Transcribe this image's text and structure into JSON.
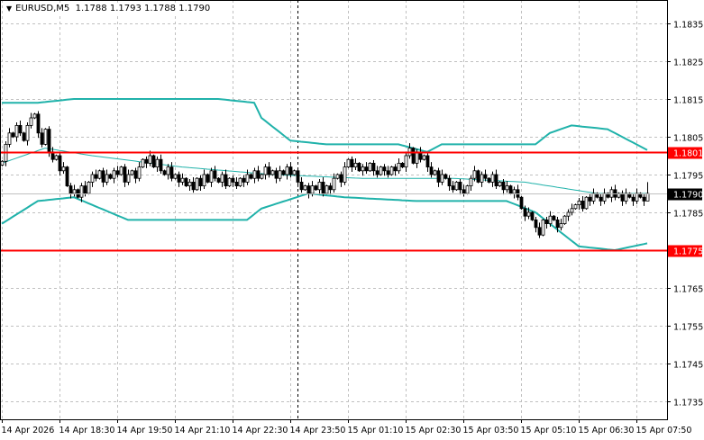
{
  "header": {
    "symbol": "EURUSD,M5",
    "open": "1.1788",
    "high": "1.1793",
    "low": "1.1788",
    "close": "1.1790"
  },
  "colors": {
    "bands": "#20b2aa",
    "level": "#ff0000",
    "bull_body": "#ffffff",
    "bear_body": "#000000",
    "grid": "#c0c0c0",
    "current_bg": "#000000"
  },
  "chart_data": {
    "type": "candlestick",
    "title": "EURUSD,M5",
    "ylim": [
      1.1731,
      1.1841
    ],
    "y_ticks": [
      "1.1835",
      "1.1825",
      "1.1815",
      "1.1805",
      "1.1795",
      "1.1785",
      "1.1775",
      "1.1765",
      "1.1755",
      "1.1745",
      "1.1735"
    ],
    "x_ticks": [
      "14 Apr 2026",
      "14 Apr 18:30",
      "14 Apr 19:50",
      "14 Apr 21:10",
      "14 Apr 22:30",
      "14 Apr 23:50",
      "15 Apr 01:10",
      "15 Apr 02:30",
      "15 Apr 03:50",
      "15 Apr 05:10",
      "15 Apr 06:30",
      "15 Apr 07:50"
    ],
    "candles_per_tick": 16,
    "levels": [
      {
        "price": 1.1801,
        "label": "1.1801"
      },
      {
        "price": 1.1775,
        "label": "1.1775"
      }
    ],
    "current_price": {
      "price": 1.179,
      "label": "1.1790"
    },
    "crosshair_candle_index": 82,
    "closes": [
      1.17985,
      1.1803,
      1.1806,
      1.1805,
      1.1808,
      1.1806,
      1.1804,
      1.1808,
      1.181,
      1.1811,
      1.1806,
      1.1803,
      1.1807,
      1.1801,
      1.1799,
      1.18,
      1.1796,
      1.1797,
      1.1792,
      1.179,
      1.1791,
      1.1789,
      1.1792,
      1.179,
      1.1793,
      1.1795,
      1.1794,
      1.1796,
      1.1793,
      1.1795,
      1.1794,
      1.1796,
      1.1795,
      1.1797,
      1.1793,
      1.1795,
      1.1796,
      1.1794,
      1.1797,
      1.1799,
      1.1798,
      1.18,
      1.1797,
      1.1799,
      1.1796,
      1.1795,
      1.1797,
      1.1794,
      1.1795,
      1.1793,
      1.1794,
      1.1792,
      1.1793,
      1.1791,
      1.1794,
      1.1792,
      1.1795,
      1.1793,
      1.1796,
      1.1794,
      1.1793,
      1.1795,
      1.1792,
      1.1794,
      1.1793,
      1.1792,
      1.1794,
      1.1793,
      1.1795,
      1.1794,
      1.1796,
      1.1794,
      1.1795,
      1.1797,
      1.1795,
      1.1796,
      1.1794,
      1.1796,
      1.1795,
      1.1797,
      1.1795,
      1.1796,
      1.1793,
      1.1791,
      1.1792,
      1.179,
      1.1792,
      1.1791,
      1.1793,
      1.179,
      1.1792,
      1.1791,
      1.1794,
      1.1795,
      1.1793,
      1.1797,
      1.1799,
      1.1797,
      1.1798,
      1.1796,
      1.1797,
      1.1796,
      1.1798,
      1.1796,
      1.1795,
      1.1797,
      1.1796,
      1.1795,
      1.1797,
      1.1796,
      1.1798,
      1.1797,
      1.18,
      1.1802,
      1.1798,
      1.1801,
      1.1799,
      1.18,
      1.1797,
      1.1795,
      1.1796,
      1.1793,
      1.1795,
      1.1794,
      1.1792,
      1.1791,
      1.1793,
      1.1791,
      1.179,
      1.1792,
      1.1794,
      1.1796,
      1.1793,
      1.1795,
      1.1794,
      1.1793,
      1.1795,
      1.1792,
      1.1793,
      1.1791,
      1.1792,
      1.179,
      1.1791,
      1.1789,
      1.1786,
      1.1784,
      1.1785,
      1.1783,
      1.1781,
      1.1779,
      1.1783,
      1.1782,
      1.1784,
      1.1783,
      1.1781,
      1.1782,
      1.1784,
      1.1785,
      1.1786,
      1.1787,
      1.1788,
      1.1786,
      1.1789,
      1.1788,
      1.179,
      1.1789,
      1.1788,
      1.179,
      1.1789,
      1.1791,
      1.1789,
      1.179,
      1.1788,
      1.179,
      1.1789,
      1.1788,
      1.179,
      1.1789,
      1.1788,
      1.179
    ],
    "bollinger": {
      "upper": [
        [
          0,
          1.1814
        ],
        [
          10,
          1.1814
        ],
        [
          20,
          1.1815
        ],
        [
          40,
          1.1815
        ],
        [
          60,
          1.1815
        ],
        [
          70,
          1.1814
        ],
        [
          72,
          1.181
        ],
        [
          80,
          1.1804
        ],
        [
          90,
          1.1803
        ],
        [
          110,
          1.1803
        ],
        [
          118,
          1.1801
        ],
        [
          122,
          1.1803
        ],
        [
          140,
          1.1803
        ],
        [
          148,
          1.1803
        ],
        [
          152,
          1.1806
        ],
        [
          158,
          1.1808
        ],
        [
          168,
          1.1807
        ],
        [
          178,
          1.1802
        ],
        [
          180,
          1.1801
        ]
      ],
      "middle": [
        [
          0,
          1.1798
        ],
        [
          12,
          1.1802
        ],
        [
          25,
          1.18
        ],
        [
          50,
          1.1797
        ],
        [
          75,
          1.1795
        ],
        [
          100,
          1.1794
        ],
        [
          125,
          1.1794
        ],
        [
          145,
          1.1793
        ],
        [
          165,
          1.179
        ],
        [
          180,
          1.179
        ]
      ],
      "lower": [
        [
          0,
          1.1782
        ],
        [
          10,
          1.1788
        ],
        [
          20,
          1.1789
        ],
        [
          35,
          1.1783
        ],
        [
          50,
          1.1783
        ],
        [
          68,
          1.1783
        ],
        [
          72,
          1.1786
        ],
        [
          85,
          1.179
        ],
        [
          95,
          1.1789
        ],
        [
          115,
          1.1788
        ],
        [
          140,
          1.1788
        ],
        [
          148,
          1.1785
        ],
        [
          160,
          1.1776
        ],
        [
          170,
          1.1775
        ],
        [
          175,
          1.1776
        ],
        [
          180,
          1.1777
        ]
      ]
    }
  }
}
